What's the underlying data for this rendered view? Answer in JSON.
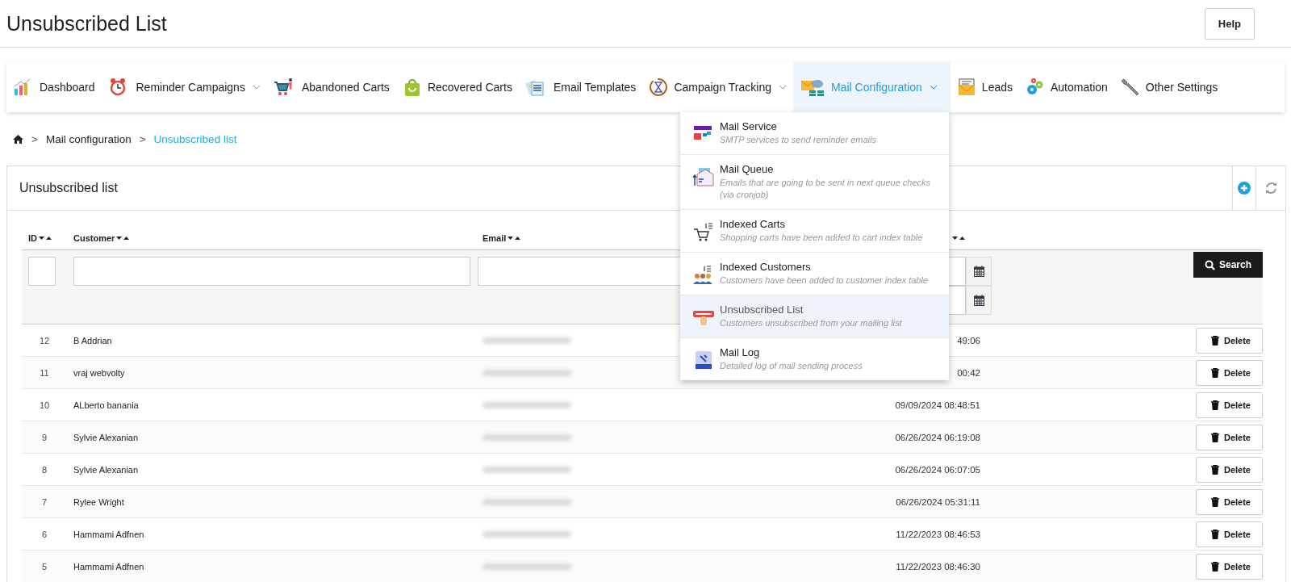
{
  "page_title": "Unsubscribed List",
  "help_button": "Help",
  "nav": [
    {
      "label": "Dashboard",
      "has_dropdown": false,
      "selected": false
    },
    {
      "label": "Reminder Campaigns",
      "has_dropdown": true,
      "selected": false
    },
    {
      "label": "Abandoned Carts",
      "has_dropdown": false,
      "selected": false
    },
    {
      "label": "Recovered Carts",
      "has_dropdown": false,
      "selected": false
    },
    {
      "label": "Email Templates",
      "has_dropdown": false,
      "selected": false
    },
    {
      "label": "Campaign Tracking",
      "has_dropdown": true,
      "selected": false
    },
    {
      "label": "Mail Configuration",
      "has_dropdown": true,
      "selected": true
    },
    {
      "label": "Leads",
      "has_dropdown": false,
      "selected": false
    },
    {
      "label": "Automation",
      "has_dropdown": false,
      "selected": false
    },
    {
      "label": "Other Settings",
      "has_dropdown": false,
      "selected": false
    }
  ],
  "dropdown": {
    "items": [
      {
        "title": "Mail Service",
        "description": "SMTP services to send reminder emails",
        "selected": false
      },
      {
        "title": "Mail Queue",
        "description": "Emails that are going to be sent in next queue checks (via cronjob)",
        "selected": false
      },
      {
        "title": "Indexed Carts",
        "description": "Shopping carts have been added to cart index table",
        "selected": false
      },
      {
        "title": "Indexed Customers",
        "description": "Customers have been added to customer index table",
        "selected": false
      },
      {
        "title": "Unsubscribed List",
        "description": "Customers unsubscribed from your mailing list",
        "selected": true
      },
      {
        "title": "Mail Log",
        "description": "Detailed log of mail sending process",
        "selected": false
      }
    ]
  },
  "breadcrumb": {
    "separator": ">",
    "items": [
      {
        "kind": "home"
      },
      {
        "kind": "link",
        "label": "Mail configuration"
      },
      {
        "kind": "current",
        "label": "Unsubscribed list"
      }
    ]
  },
  "panel": {
    "title": "Unsubscribed list",
    "columns": [
      {
        "label": "ID",
        "kind": "text"
      },
      {
        "label": "Customer",
        "kind": "text"
      },
      {
        "label": "Email",
        "kind": "text"
      },
      {
        "kind": "date_range"
      },
      {
        "kind": "search"
      }
    ],
    "search_button": "Search",
    "rows": [
      {
        "id": "12",
        "customer": "B Addrian",
        "date": "49:06",
        "action": "Delete"
      },
      {
        "id": "11",
        "customer": "vraj webvolty",
        "date": "00:42",
        "action": "Delete"
      },
      {
        "id": "10",
        "customer": "ALberto banania",
        "date": "09/09/2024 08:48:51",
        "action": "Delete"
      },
      {
        "id": "9",
        "customer": "Sylvie Alexanian",
        "date": "06/26/2024 06:19:08",
        "action": "Delete"
      },
      {
        "id": "8",
        "customer": "Sylvie Alexanian",
        "date": "06/26/2024 06:07:05",
        "action": "Delete"
      },
      {
        "id": "7",
        "customer": "Rylee Wright",
        "date": "06/26/2024 05:31:11",
        "action": "Delete"
      },
      {
        "id": "6",
        "customer": "Hammami Adfnen",
        "date": "11/22/2023 08:46:53",
        "action": "Delete"
      },
      {
        "id": "5",
        "customer": "Hammami Adfnen",
        "date": "11/22/2023 08:46:30",
        "action": "Delete"
      }
    ]
  }
}
